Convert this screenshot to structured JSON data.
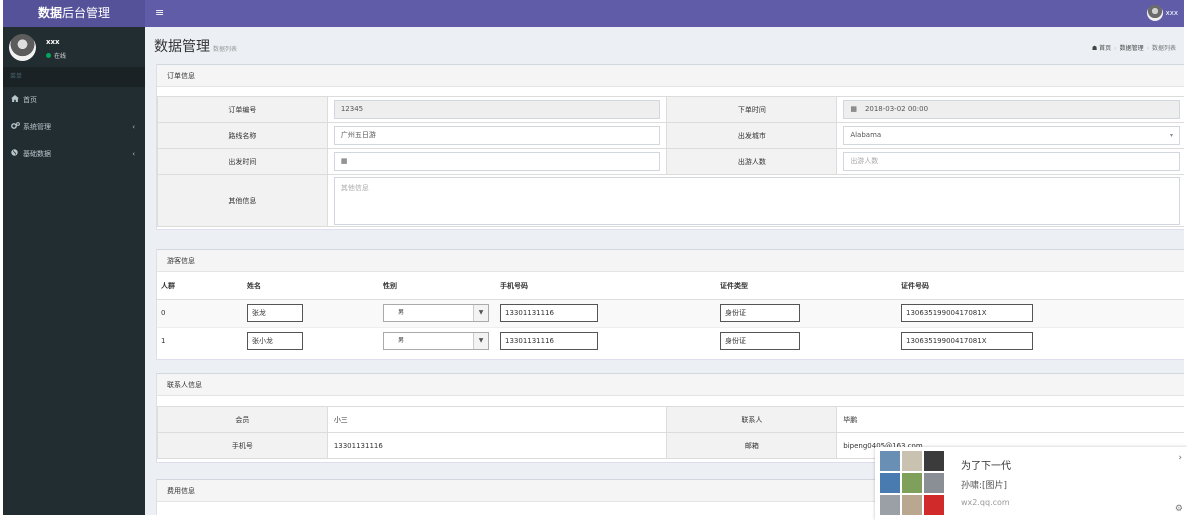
{
  "header": {
    "brand_bold": "数据",
    "brand_rest": "后台管理",
    "menu_toggle": "≡",
    "user": "xxx"
  },
  "sidebar": {
    "user": "xxx",
    "status": "在线",
    "menu_header": "菜单",
    "items": [
      {
        "label": "首页",
        "icon": "home-icon"
      },
      {
        "label": "系统管理",
        "icon": "gears-icon",
        "arrow": "‹"
      },
      {
        "label": "基础数据",
        "icon": "globe-icon",
        "arrow": "‹"
      }
    ]
  },
  "page": {
    "title": "数据管理",
    "subtitle": "数据列表"
  },
  "breadcrumb": {
    "home": "首页",
    "section": "数据管理",
    "current": "数据列表"
  },
  "order": {
    "title": "订单信息",
    "order_no_label": "订单编号",
    "order_no": "12345",
    "order_time_label": "下单时间",
    "order_time": "2018-03-02 00:00",
    "route_label": "路线名称",
    "route": "广州五日游",
    "city_label": "出发城市",
    "city": "Alabama",
    "depart_label": "出发时间",
    "depart_value": "",
    "people_label": "出游人数",
    "people_placeholder": "出游人数",
    "other_label": "其他信息",
    "other_placeholder": "其他信息"
  },
  "tourists": {
    "title": "游客信息",
    "columns": [
      "人群",
      "姓名",
      "性别",
      "手机号码",
      "证件类型",
      "证件号码"
    ],
    "rows": [
      {
        "index": "0",
        "name": "张龙",
        "gender": "男",
        "phone": "13301131116",
        "id_type": "身份证",
        "id_no": "130635199004170​81X"
      },
      {
        "index": "1",
        "name": "张小龙",
        "gender": "男",
        "phone": "13301131116",
        "id_type": "身份证",
        "id_no": "13063519900417081X"
      }
    ]
  },
  "contact": {
    "title": "联系人信息",
    "member_label": "会员",
    "member": "小三",
    "contact_label": "联系人",
    "contact": "毕鹏",
    "phone_label": "手机号",
    "phone": "13301131116",
    "email_label": "邮箱",
    "email": "bipeng0405@163.com"
  },
  "fees": {
    "title": "费用信息"
  },
  "notification": {
    "title": "为了下一代",
    "message": "孙啸:[图片]",
    "source": "wx2.qq.com",
    "close": "›",
    "settings": "⚙"
  }
}
